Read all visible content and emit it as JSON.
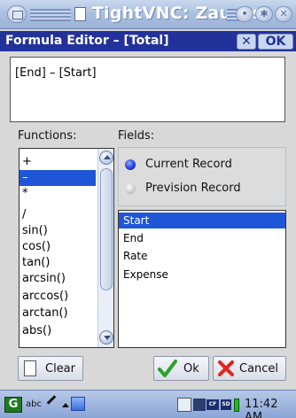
{
  "window": {
    "title": "TightVNC: Zaurus"
  },
  "dialog": {
    "title": "Formula Editor – [Total]",
    "close_label": "✕",
    "ok_label": "OK",
    "formula": "[End] – [Start]"
  },
  "functions": {
    "label": "Functions:",
    "items": [
      "+",
      "–",
      "*",
      "/",
      "sin()",
      "cos()",
      "tan()",
      "arcsin()",
      "arccos()",
      "arctan()",
      "abs()"
    ],
    "selected": "–"
  },
  "fields": {
    "label": "Fields:",
    "records": [
      {
        "label": "Current Record",
        "checked": true
      },
      {
        "label": "Prevision Record",
        "checked": false
      }
    ],
    "items": [
      "Start",
      "End",
      "Rate",
      "Expense"
    ],
    "selected": "Start"
  },
  "buttons": {
    "clear": "Clear",
    "ok": "Ok",
    "cancel": "Cancel"
  },
  "taskbar": {
    "start_icon": "G",
    "input_mode": "abc",
    "card_cf": "CF",
    "card_sd": "SD",
    "clock": "11:42 AM"
  },
  "colors": {
    "selection": "#1f56d8",
    "dialog_title_bg": "#23329a",
    "ok_check": "#2aa12a",
    "cancel_x": "#e0241e"
  }
}
